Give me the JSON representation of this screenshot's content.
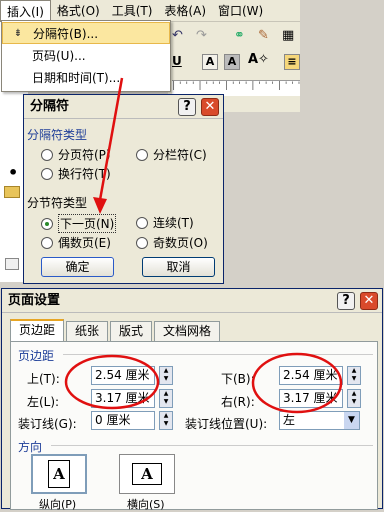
{
  "menubar": {
    "items": [
      "插入(I)",
      "格式(O)",
      "工具(T)",
      "表格(A)",
      "窗口(W)"
    ]
  },
  "insert_menu": {
    "items": [
      "分隔符(B)...",
      "页码(U)...",
      "日期和时间(T)..."
    ]
  },
  "break_dialog": {
    "title": "分隔符",
    "break_types_label": "分隔符类型",
    "page_break": "分页符(P)",
    "column_break": "分栏符(C)",
    "text_wrap_break": "换行符(T)",
    "section_break_label": "分节符类型",
    "next_page": "下一页(N)",
    "continuous": "连续(T)",
    "even_page": "偶数页(E)",
    "odd_page": "奇数页(O)",
    "ok": "确定",
    "cancel": "取消"
  },
  "page_setup": {
    "title": "页面设置",
    "tabs": [
      "页边距",
      "纸张",
      "版式",
      "文档网格"
    ],
    "margins_label": "页边距",
    "top_label": "上(T):",
    "top_value": "2.54 厘米",
    "bottom_label": "下(B):",
    "bottom_value": "2.54 厘米",
    "left_label": "左(L):",
    "left_value": "3.17 厘米",
    "right_label": "右(R):",
    "right_value": "3.17 厘米",
    "gutter_label": "装订线(G):",
    "gutter_value": "0 厘米",
    "gutter_pos_label": "装订线位置(U):",
    "gutter_pos_value": "左",
    "orientation_label": "方向",
    "portrait": "纵向(P)",
    "landscape": "横向(S)"
  },
  "colors": {
    "annotation": "#e01010",
    "accent": "#1f3f99"
  }
}
